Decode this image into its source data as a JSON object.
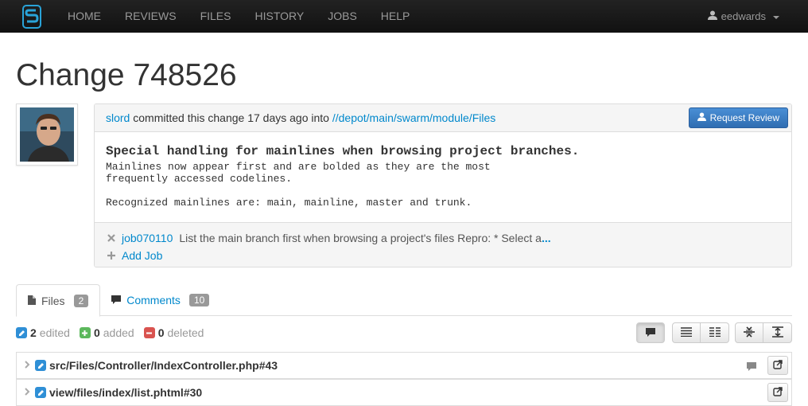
{
  "nav": {
    "items": [
      "HOME",
      "REVIEWS",
      "FILES",
      "HISTORY",
      "JOBS",
      "HELP"
    ],
    "user": "eedwards"
  },
  "page": {
    "title": "Change 748526"
  },
  "change": {
    "author": "slord",
    "committed_text": " committed this change 17 days ago into ",
    "path": "//depot/main/swarm/module/Files",
    "request_review_label": "Request Review",
    "desc_title": "Special handling for mainlines when browsing project branches.",
    "desc_body": "Mainlines now appear first and are bolded as they are the most\nfrequently accessed codelines.\n\nRecognized mainlines are: main, mainline, master and trunk.",
    "job": {
      "id": "job070110",
      "description": "List the main branch first when browsing a project's files Repro: * Select a",
      "more": "..."
    },
    "add_job_label": "Add Job"
  },
  "tabs": [
    {
      "label": "Files",
      "count": "2"
    },
    {
      "label": "Comments",
      "count": "10"
    }
  ],
  "summary": {
    "edited_count": "2",
    "edited_label": "edited",
    "added_count": "0",
    "added_label": "added",
    "deleted_count": "0",
    "deleted_label": "deleted"
  },
  "files": [
    {
      "path": "src/Files/Controller/IndexController.php#43",
      "has_comments": true
    },
    {
      "path": "view/files/index/list.phtml#30",
      "has_comments": false
    }
  ],
  "colors": {
    "accent": "#0088cc",
    "navbar": "#1b1b1b",
    "edit": "#2f8fd6",
    "add": "#5cb85c",
    "delete": "#d9534f"
  }
}
